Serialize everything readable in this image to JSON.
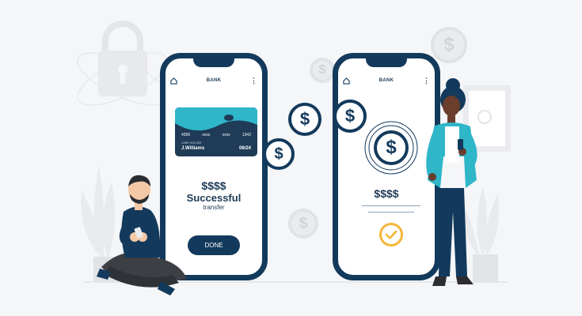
{
  "phone_left": {
    "title": "BANK",
    "card": {
      "number_groups": [
        "4356",
        "xxxx",
        "xxxx",
        "1342"
      ],
      "holder_label": "CARD HOLDER",
      "holder_name": "J.Williams",
      "expiry": "06/24"
    },
    "amount": "$$$$",
    "status": "Successful",
    "status_sub": "transfer",
    "done_label": "DONE"
  },
  "phone_right": {
    "title": "BANK",
    "amount": "$$$$"
  },
  "coin_symbol": "$",
  "colors": {
    "navy": "#133a5c",
    "teal": "#2fb6c9",
    "check": "#f4b63a",
    "background": "#f5f6f8"
  }
}
